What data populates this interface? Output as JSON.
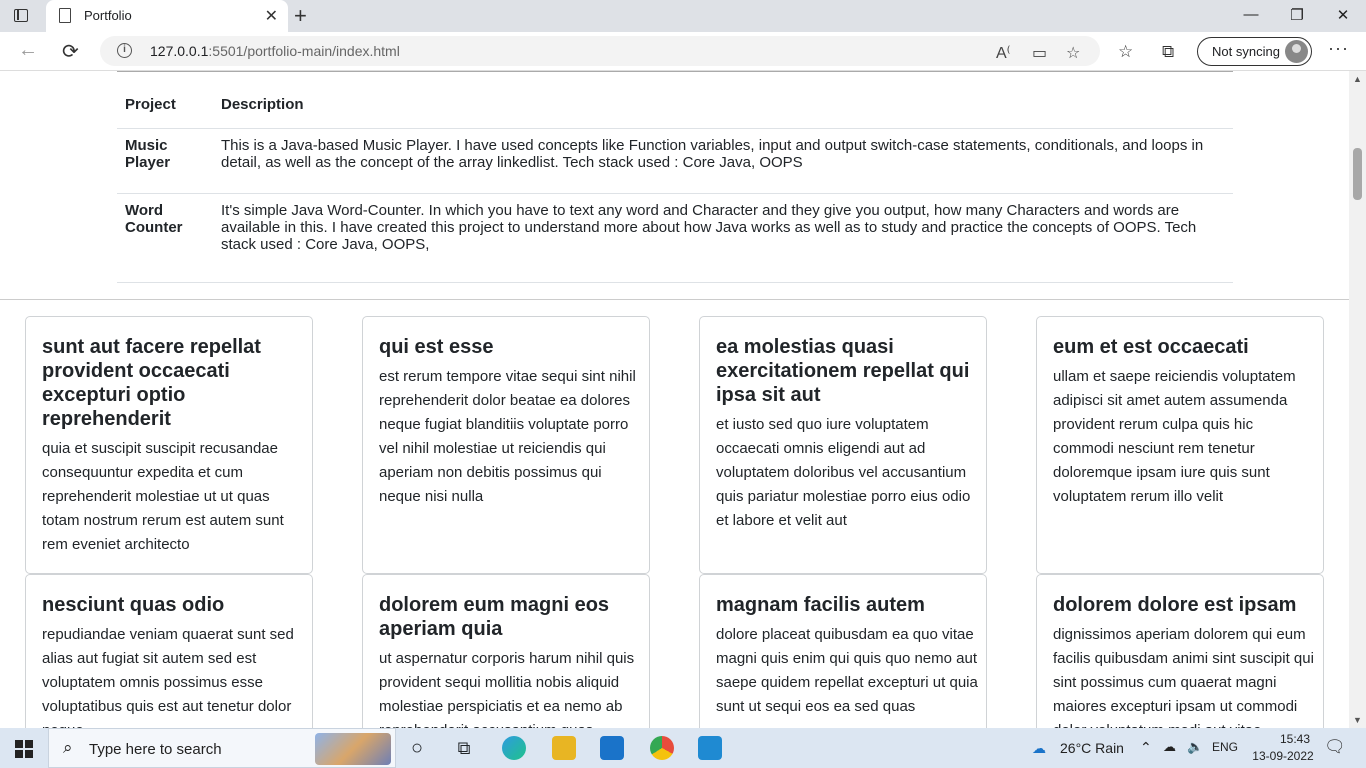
{
  "browser": {
    "tab_title": "Portfolio",
    "url_host": "127.0.0.1",
    "url_rest": ":5501/portfolio-main/index.html",
    "sync_label": "Not syncing"
  },
  "table": {
    "headers": {
      "project": "Project",
      "description": "Description"
    },
    "rows": [
      {
        "name": "Music Player",
        "description": "This is a Java-based Music Player. I have used concepts like Function variables, input and output switch-case statements, conditionals, and loops in detail, as well as the concept of the array linkedlist. Tech stack used : Core Java, OOPS"
      },
      {
        "name": "Word Counter",
        "description": "It's simple Java Word-Counter. In which you have to text any word and Character and they give you output, how many Characters and words are available in this. I have created this project to understand more about how Java works as well as to study and practice the concepts of OOPS. Tech stack used : Core Java, OOPS,"
      }
    ]
  },
  "cards": [
    {
      "title": "sunt aut facere repellat provident occaecati excepturi optio reprehenderit",
      "body": "quia et suscipit suscipit recusandae consequuntur expedita et cum reprehenderit molestiae ut ut quas totam nostrum rerum est autem sunt rem eveniet architecto"
    },
    {
      "title": "qui est esse",
      "body": "est rerum tempore vitae sequi sint nihil reprehenderit dolor beatae ea dolores neque fugiat blanditiis voluptate porro vel nihil molestiae ut reiciendis qui aperiam non debitis possimus qui neque nisi nulla"
    },
    {
      "title": "ea molestias quasi exercitationem repellat qui ipsa sit aut",
      "body": "et iusto sed quo iure voluptatem occaecati omnis eligendi aut ad voluptatem doloribus vel accusantium quis pariatur molestiae porro eius odio et labore et velit aut"
    },
    {
      "title": "eum et est occaecati",
      "body": "ullam et saepe reiciendis voluptatem adipisci sit amet autem assumenda provident rerum culpa quis hic commodi nesciunt rem tenetur doloremque ipsam iure quis sunt voluptatem rerum illo velit"
    },
    {
      "title": "nesciunt quas odio",
      "body": "repudiandae veniam quaerat sunt sed alias aut fugiat sit autem sed est voluptatem omnis possimus esse voluptatibus quis est aut tenetur dolor neque"
    },
    {
      "title": "dolorem eum magni eos aperiam quia",
      "body": "ut aspernatur corporis harum nihil quis provident sequi mollitia nobis aliquid molestiae perspiciatis et ea nemo ab reprehenderit accusantium quas"
    },
    {
      "title": "magnam facilis autem",
      "body": "dolore placeat quibusdam ea quo vitae magni quis enim qui quis quo nemo aut saepe quidem repellat excepturi ut quia sunt ut sequi eos ea sed quas"
    },
    {
      "title": "dolorem dolore est ipsam",
      "body": "dignissimos aperiam dolorem qui eum facilis quibusdam animi sint suscipit qui sint possimus cum quaerat magni maiores excepturi ipsam ut commodi dolor voluptatum modi aut vitae"
    }
  ],
  "taskbar": {
    "search_placeholder": "Type here to search",
    "weather": "26°C  Rain",
    "language": "ENG",
    "time": "15:43",
    "date": "13-09-2022"
  }
}
